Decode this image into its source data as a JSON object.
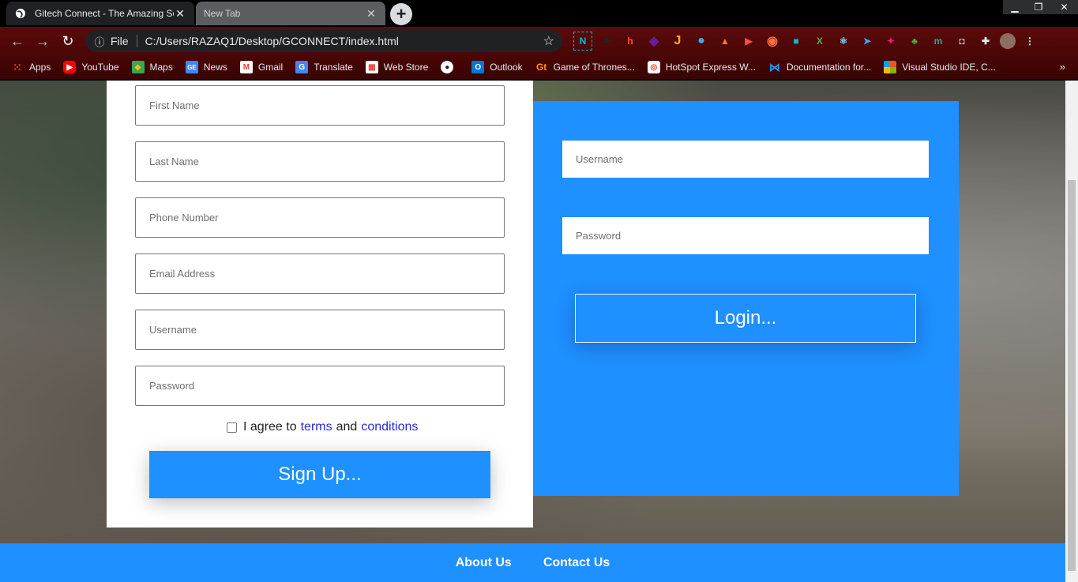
{
  "browser": {
    "tabs": [
      {
        "title": "Gitech Connect - The Amazing So",
        "active": true
      },
      {
        "title": "New Tab",
        "active": false
      }
    ],
    "new_tab_symbol": "+",
    "url_scheme": "File",
    "url": "C:/Users/RAZAQ1/Desktop/GCONNECT/index.html",
    "bookmarks": [
      {
        "label": "Apps",
        "icon": "apps-grid-icon"
      },
      {
        "label": "YouTube",
        "icon": "youtube-icon"
      },
      {
        "label": "Maps",
        "icon": "maps-icon"
      },
      {
        "label": "News",
        "icon": "news-icon"
      },
      {
        "label": "Gmail",
        "icon": "gmail-icon"
      },
      {
        "label": "Translate",
        "icon": "translate-icon"
      },
      {
        "label": "Web Store",
        "icon": "webstore-icon"
      },
      {
        "label": "",
        "icon": "globe-icon"
      },
      {
        "label": "Outlook",
        "icon": "outlook-icon"
      },
      {
        "label": "Game of Thrones...",
        "icon": "got-icon"
      },
      {
        "label": "HotSpot Express W...",
        "icon": "hotspot-icon"
      },
      {
        "label": "Documentation for...",
        "icon": "vscode-icon"
      },
      {
        "label": "Visual Studio IDE, C...",
        "icon": "microsoft-icon"
      }
    ]
  },
  "signup": {
    "placeholders": {
      "first_name": "First Name",
      "last_name": "Last Name",
      "phone": "Phone Number",
      "email": "Email Address",
      "username": "Username",
      "password": "Password"
    },
    "agree_prefix": "I agree to",
    "terms": "terms",
    "and": "and",
    "conditions": "conditions",
    "button": "Sign Up..."
  },
  "login": {
    "placeholders": {
      "username": "Username",
      "password": "Password"
    },
    "button": "Login..."
  },
  "footer": {
    "about": "About Us",
    "contact": "Contact Us"
  },
  "colors": {
    "accent": "#1e90ff",
    "browser_theme": "#4a0606"
  }
}
